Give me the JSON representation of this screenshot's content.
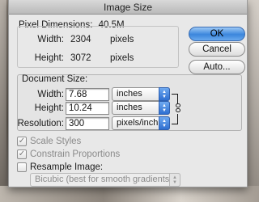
{
  "window": {
    "title": "Image Size"
  },
  "pixel_dimensions": {
    "title": "Pixel Dimensions:",
    "size": "40.5M",
    "width_label": "Width:",
    "width_value": "2304",
    "width_unit": "pixels",
    "height_label": "Height:",
    "height_value": "3072",
    "height_unit": "pixels"
  },
  "document_size": {
    "title": "Document Size:",
    "width_label": "Width:",
    "width_value": "7.68",
    "width_unit": "inches",
    "height_label": "Height:",
    "height_value": "10.24",
    "height_unit": "inches",
    "resolution_label": "Resolution:",
    "resolution_value": "300",
    "resolution_unit": "pixels/inch"
  },
  "buttons": {
    "ok": "OK",
    "cancel": "Cancel",
    "auto": "Auto..."
  },
  "options": {
    "scale_styles": {
      "label": "Scale Styles",
      "checked": true,
      "enabled": false
    },
    "constrain_proportions": {
      "label": "Constrain Proportions",
      "checked": true,
      "enabled": false
    },
    "resample_image": {
      "label": "Resample Image:",
      "checked": false,
      "enabled": true
    },
    "resample_method": "Bicubic (best for smooth gradients)"
  },
  "icons": {
    "popup_arrows": "up-down-arrows-icon",
    "link": "chain-link-icon",
    "check": "checkmark-icon"
  }
}
